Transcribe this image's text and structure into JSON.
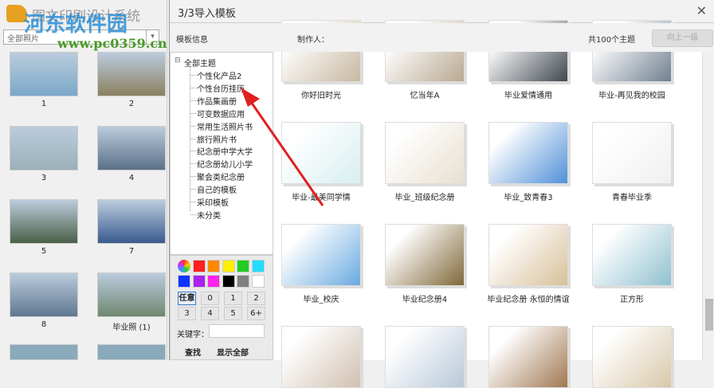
{
  "app": {
    "title": "图文印刷设计系统",
    "album_select": "全部照片"
  },
  "left_photos": [
    {
      "label": "1",
      "color": "#7aa8c8"
    },
    {
      "label": "2",
      "color": "#8a8060"
    },
    {
      "label": "3",
      "color": "#9ab0b8"
    },
    {
      "label": "4",
      "color": "#5a7088"
    },
    {
      "label": "5",
      "color": "#4a6048"
    },
    {
      "label": "7",
      "color": "#3a5a90"
    },
    {
      "label": "8",
      "color": "#607890"
    },
    {
      "label": "毕业照 (1)",
      "color": "#708870"
    }
  ],
  "dialog": {
    "title": "3/3导入模板",
    "close": "✕",
    "info_label": "模板信息",
    "author_label": "制作人：",
    "count": "共100个主题",
    "up_button": "向上一级"
  },
  "tree": {
    "root": "全部主题",
    "items": [
      "个性化产品2",
      "个性台历挂历",
      "作品集画册",
      "可变数据应用",
      "常用生活照片书",
      "旅行照片书",
      "纪念册中学大学",
      "纪念册幼儿小学",
      "聚会类纪念册",
      "自己的模板",
      "采印模板",
      "未分类"
    ]
  },
  "palette": {
    "colors": [
      "#ff2020",
      "#ff8800",
      "#ffee00",
      "#22cc22",
      "#22ddff",
      "#1133ff",
      "#aa22ee",
      "#ff22ee",
      "#000000",
      "#808080",
      "#ffffff"
    ],
    "pages": [
      "任意",
      "0",
      "1",
      "2",
      "3",
      "4",
      "5",
      "6+"
    ],
    "keyword_label": "关键字：",
    "keyword_value": "",
    "search": "查找",
    "show_all": "显示全部"
  },
  "templates": [
    {
      "label": "你好旧时光",
      "color": "#c8b8a0"
    },
    {
      "label": "忆当年A",
      "color": "#b8a890"
    },
    {
      "label": "毕业爱情通用",
      "color": "#404850"
    },
    {
      "label": "毕业-再见我的校园",
      "color": "#708090"
    },
    {
      "label": "毕业-最美同学情",
      "color": "#d8eef0"
    },
    {
      "label": "毕业_班级纪念册",
      "color": "#e8e0d0"
    },
    {
      "label": "毕业_致青春3",
      "color": "#5090d8"
    },
    {
      "label": "青春毕业季",
      "color": "#f0f0f0"
    },
    {
      "label": "毕业_校庆",
      "color": "#6aaae0"
    },
    {
      "label": "毕业纪念册4",
      "color": "#806838"
    },
    {
      "label": "毕业纪念册 永恒的情谊",
      "color": "#d8c098"
    },
    {
      "label": "正方形",
      "color": "#90c0d0"
    },
    {
      "label": "",
      "color": "#d0c0b0"
    },
    {
      "label": "",
      "color": "#b8c8d8"
    },
    {
      "label": "",
      "color": "#a07850"
    },
    {
      "label": "",
      "color": "#d8c8a8"
    }
  ],
  "watermark": {
    "name": "河东软件园",
    "url": "www.pc0359.cn"
  }
}
